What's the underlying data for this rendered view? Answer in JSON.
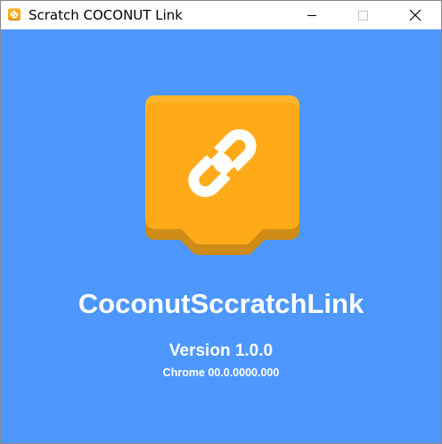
{
  "window": {
    "title": "Scratch COCONUT Link",
    "app_icon": "scratch-link-icon",
    "controls": {
      "minimize_icon": "minimize-icon",
      "maximize_icon": "maximize-icon",
      "close_icon": "close-icon"
    }
  },
  "main": {
    "logo_icon": "chain-link-icon",
    "app_name": "CoconutSccratchLink",
    "version": "Version 1.0.0",
    "chrome_version": "Chrome 00.0.0000.000"
  },
  "colors": {
    "background": "#4d97ff",
    "logo_fill": "#ffab19",
    "logo_shadow": "#cf8b17",
    "text": "#ffffff"
  }
}
